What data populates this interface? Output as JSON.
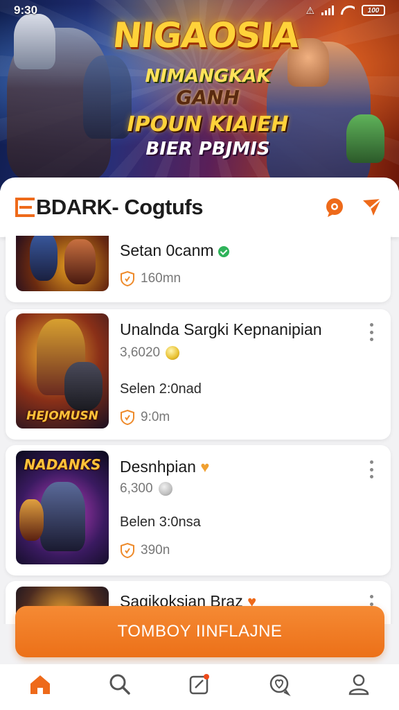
{
  "status_bar": {
    "time": "9:30",
    "battery": "100"
  },
  "hero": {
    "title": "NIGAOSIA",
    "line1": "NIMANGKAK",
    "line2": "GANH",
    "line3": "IPOUN KIAIEH",
    "line4": "BIER PBJMIS"
  },
  "header": {
    "brand_mark": "E",
    "title": "BDARK- Cogtufs"
  },
  "colors": {
    "accent": "#ee6a1a",
    "verified": "#2fb35a",
    "background": "#f2f2f4"
  },
  "cards": [
    {
      "thumb_label": "",
      "title": "Setan 0canm",
      "badge": "verified",
      "meta": "160mn"
    },
    {
      "thumb_label": "HEJOMUSN",
      "title": "Unalnda Sargki Kepnanipian",
      "price": "3,6020",
      "line": "Selen 2:0nad",
      "meta": "9:0m"
    },
    {
      "thumb_label": "NADANKS",
      "title": "Desnhpian",
      "price": "6,300",
      "line": "Belen 3:0nsa",
      "meta": "390n"
    },
    {
      "title": "Sagikoksian Braz"
    }
  ],
  "cta": {
    "label": "TOMBOY IINFLAJNE"
  },
  "nav": {
    "items": [
      "home-icon",
      "search-icon",
      "edit-icon",
      "heart-chat-icon",
      "profile-icon"
    ],
    "active": "home"
  }
}
